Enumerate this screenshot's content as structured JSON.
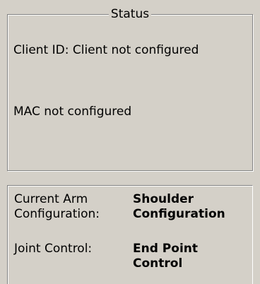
{
  "status": {
    "title": "Status",
    "client_id": "Client ID: Client not configured",
    "mac": "MAC not configured"
  },
  "arm": {
    "configuration_label_line1": "Current Arm",
    "configuration_label_line2": "Configuration:",
    "configuration_value_line1": "Shoulder",
    "configuration_value_line2": "Configuration",
    "joint_control_label": "Joint Control:",
    "joint_control_value_line1": "End Point",
    "joint_control_value_line2": "Control"
  }
}
